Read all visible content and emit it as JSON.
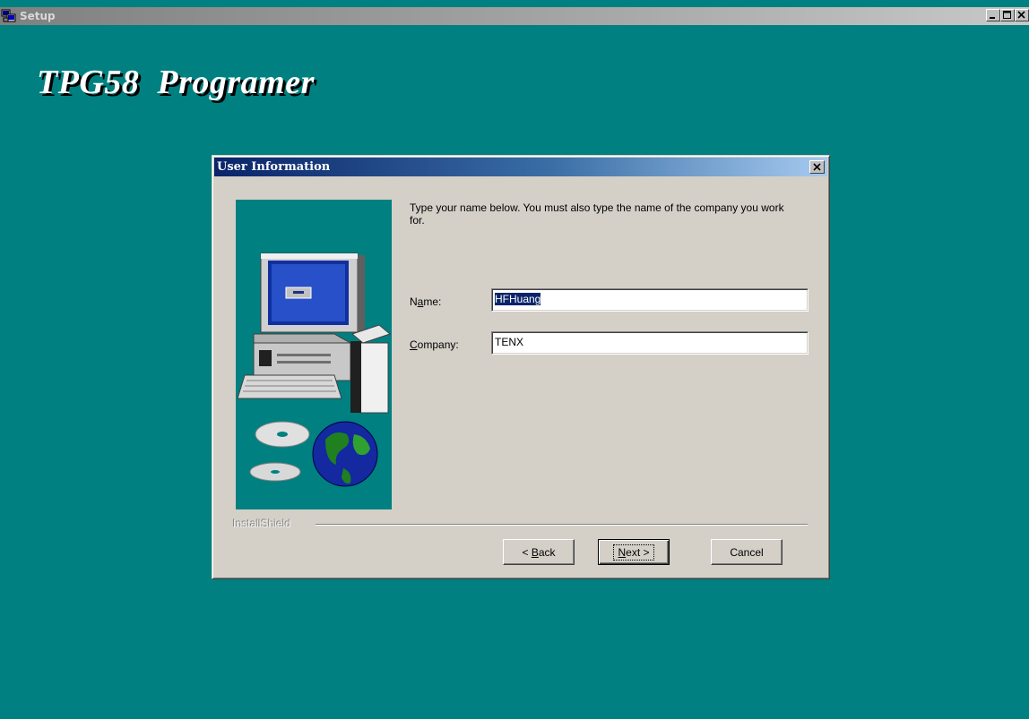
{
  "window": {
    "title": "Setup",
    "controls": [
      "_",
      "□",
      "×"
    ]
  },
  "headline": "TPG58  Programer",
  "dialog": {
    "title": "User Information",
    "close_glyph": "×",
    "instructions": "Type your name below. You must also type the name of the company you work for.",
    "name_label_pre": "N",
    "name_label_accel": "a",
    "name_label_post": "me:",
    "name_value": "HFHuang",
    "company_label_accel": "C",
    "company_label_post": "ompany:",
    "company_value": "TENX",
    "brand": "InstallShield",
    "buttons": {
      "back_pre": "< ",
      "back_accel": "B",
      "back_post": "ack",
      "next_accel": "N",
      "next_post": "ext >",
      "cancel": "Cancel"
    }
  },
  "colors": {
    "desktop": "#008080",
    "dialog_face": "#d4d0c8",
    "title_active_start": "#0a246a",
    "title_active_end": "#a6caf0",
    "selection": "#0a246a"
  },
  "icons": {
    "app": "setup-app-icon",
    "artwork": "computer-and-globe-setup-artwork"
  }
}
